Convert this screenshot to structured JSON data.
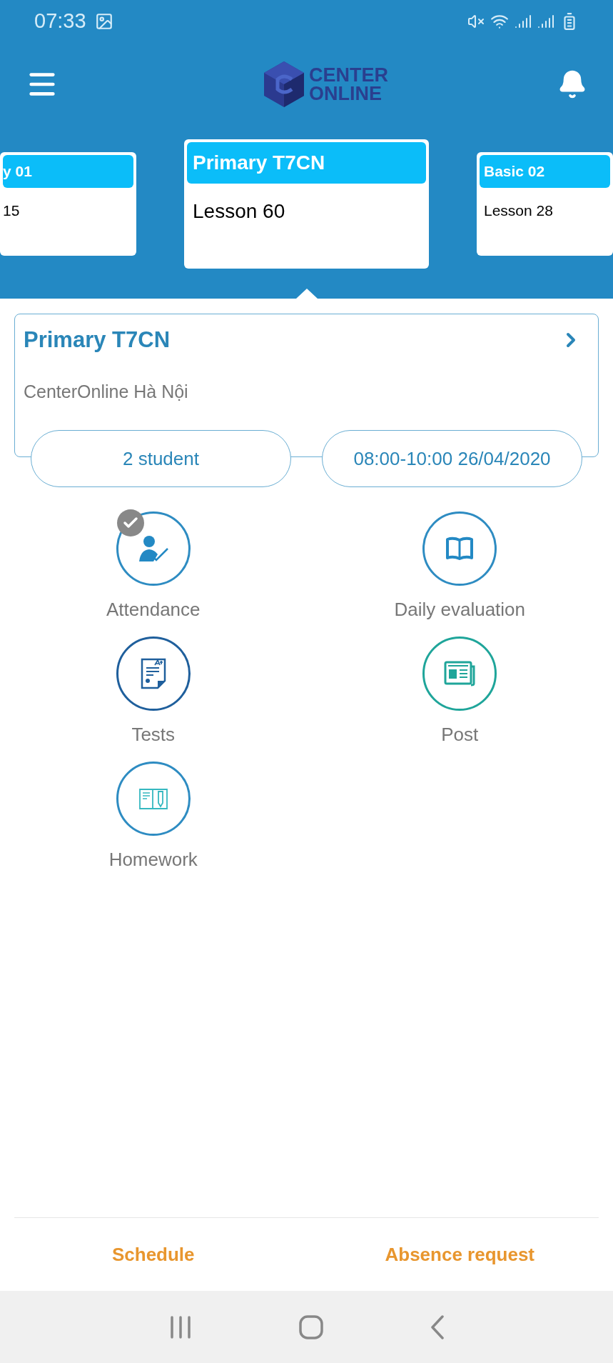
{
  "status_bar": {
    "time": "07:33"
  },
  "header": {
    "logo_top": "CENTER",
    "logo_bottom": "ONLINE"
  },
  "class_cards": [
    {
      "title": "y 01",
      "lesson": "15",
      "selected": false
    },
    {
      "title": "Primary T7CN",
      "lesson": "Lesson 60",
      "selected": true
    },
    {
      "title": "Basic 02",
      "lesson": "Lesson 28",
      "selected": false
    }
  ],
  "class_detail": {
    "title": "Primary T7CN",
    "location": "CenterOnline Hà Nội",
    "students": "2 student",
    "time": "08:00-10:00 26/04/2020"
  },
  "actions": [
    {
      "kind": "attendance",
      "label": "Attendance",
      "done": true
    },
    {
      "kind": "evaluation",
      "label": "Daily evaluation",
      "done": false
    },
    {
      "kind": "tests",
      "label": "Tests",
      "done": false
    },
    {
      "kind": "post",
      "label": "Post",
      "done": false
    },
    {
      "kind": "homework",
      "label": "Homework",
      "done": false
    }
  ],
  "bottom_buttons": [
    "Schedule",
    "Absence request"
  ]
}
